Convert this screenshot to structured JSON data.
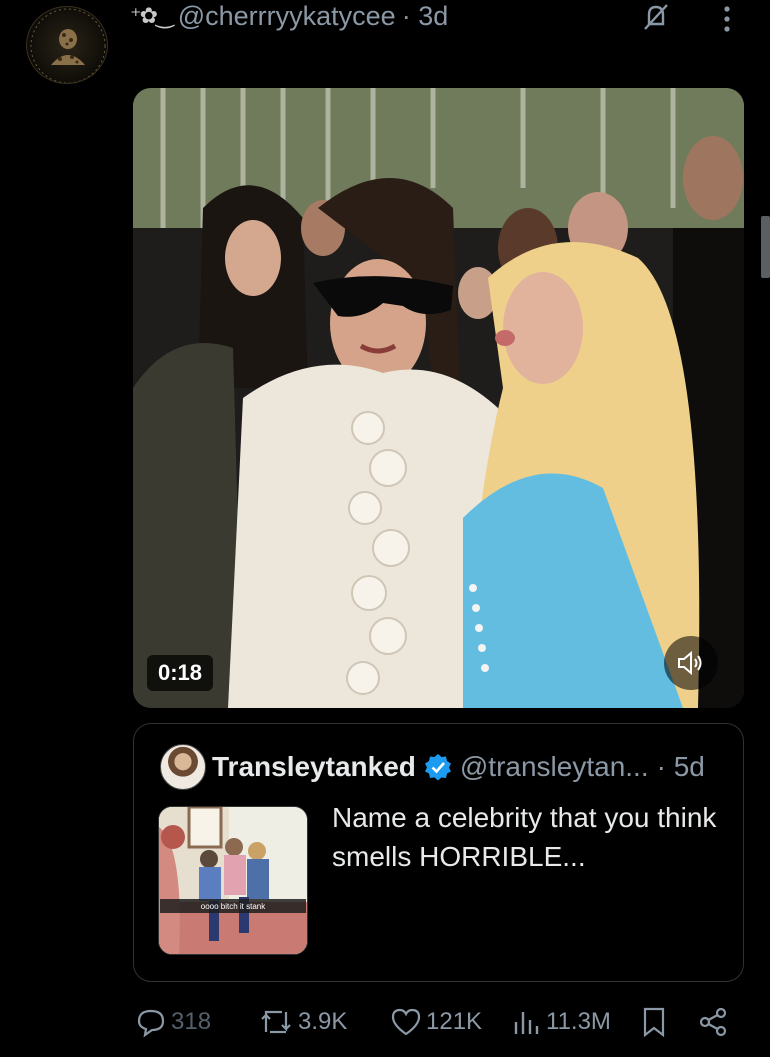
{
  "tweet": {
    "decoration": "⁺✿‿",
    "handle": "@cherrryykatycee",
    "time": "· 3d"
  },
  "video": {
    "duration": "0:18"
  },
  "quote": {
    "name": "Transleytanked",
    "handle": "@transleytan...",
    "time": "· 5d",
    "text": "Name a celebrity that you think smells HORRIBLE...",
    "thumb_caption": "oooo bitch it stank"
  },
  "actions": {
    "replies": "318",
    "retweets": "3.9K",
    "likes": "121K",
    "views": "11.3M"
  },
  "colors": {
    "background": "#000000",
    "text": "#e7e9ea",
    "muted": "#8b98a5",
    "verified": "#1d9bf0"
  },
  "icons": [
    "no-notifications-icon",
    "more-icon",
    "volume-icon",
    "verified-icon",
    "reply-icon",
    "retweet-icon",
    "like-icon",
    "views-icon",
    "bookmark-icon",
    "share-icon"
  ]
}
